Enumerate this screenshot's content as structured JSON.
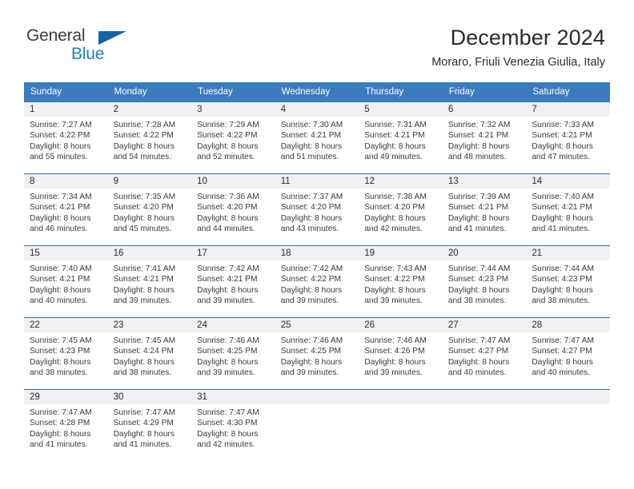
{
  "brand": {
    "line1": "General",
    "line2": "Blue",
    "triangle_icon": "triangle-logo-icon",
    "color_dark": "#3b3b3b",
    "color_blue": "#1f7fc4"
  },
  "header": {
    "title": "December 2024",
    "subtitle": "Moraro, Friuli Venezia Giulia, Italy"
  },
  "colors": {
    "header_blue": "#3a7cbe",
    "rule_blue": "#2f6fad",
    "date_band": "#f0f0f0"
  },
  "weekday_headers": [
    "Sunday",
    "Monday",
    "Tuesday",
    "Wednesday",
    "Thursday",
    "Friday",
    "Saturday"
  ],
  "weeks": [
    [
      {
        "day": "1",
        "sunrise": "Sunrise: 7:27 AM",
        "sunset": "Sunset: 4:22 PM",
        "daylight1": "Daylight: 8 hours",
        "daylight2": "and 55 minutes."
      },
      {
        "day": "2",
        "sunrise": "Sunrise: 7:28 AM",
        "sunset": "Sunset: 4:22 PM",
        "daylight1": "Daylight: 8 hours",
        "daylight2": "and 54 minutes."
      },
      {
        "day": "3",
        "sunrise": "Sunrise: 7:29 AM",
        "sunset": "Sunset: 4:22 PM",
        "daylight1": "Daylight: 8 hours",
        "daylight2": "and 52 minutes."
      },
      {
        "day": "4",
        "sunrise": "Sunrise: 7:30 AM",
        "sunset": "Sunset: 4:21 PM",
        "daylight1": "Daylight: 8 hours",
        "daylight2": "and 51 minutes."
      },
      {
        "day": "5",
        "sunrise": "Sunrise: 7:31 AM",
        "sunset": "Sunset: 4:21 PM",
        "daylight1": "Daylight: 8 hours",
        "daylight2": "and 49 minutes."
      },
      {
        "day": "6",
        "sunrise": "Sunrise: 7:32 AM",
        "sunset": "Sunset: 4:21 PM",
        "daylight1": "Daylight: 8 hours",
        "daylight2": "and 48 minutes."
      },
      {
        "day": "7",
        "sunrise": "Sunrise: 7:33 AM",
        "sunset": "Sunset: 4:21 PM",
        "daylight1": "Daylight: 8 hours",
        "daylight2": "and 47 minutes."
      }
    ],
    [
      {
        "day": "8",
        "sunrise": "Sunrise: 7:34 AM",
        "sunset": "Sunset: 4:21 PM",
        "daylight1": "Daylight: 8 hours",
        "daylight2": "and 46 minutes."
      },
      {
        "day": "9",
        "sunrise": "Sunrise: 7:35 AM",
        "sunset": "Sunset: 4:20 PM",
        "daylight1": "Daylight: 8 hours",
        "daylight2": "and 45 minutes."
      },
      {
        "day": "10",
        "sunrise": "Sunrise: 7:36 AM",
        "sunset": "Sunset: 4:20 PM",
        "daylight1": "Daylight: 8 hours",
        "daylight2": "and 44 minutes."
      },
      {
        "day": "11",
        "sunrise": "Sunrise: 7:37 AM",
        "sunset": "Sunset: 4:20 PM",
        "daylight1": "Daylight: 8 hours",
        "daylight2": "and 43 minutes."
      },
      {
        "day": "12",
        "sunrise": "Sunrise: 7:38 AM",
        "sunset": "Sunset: 4:20 PM",
        "daylight1": "Daylight: 8 hours",
        "daylight2": "and 42 minutes."
      },
      {
        "day": "13",
        "sunrise": "Sunrise: 7:39 AM",
        "sunset": "Sunset: 4:21 PM",
        "daylight1": "Daylight: 8 hours",
        "daylight2": "and 41 minutes."
      },
      {
        "day": "14",
        "sunrise": "Sunrise: 7:40 AM",
        "sunset": "Sunset: 4:21 PM",
        "daylight1": "Daylight: 8 hours",
        "daylight2": "and 41 minutes."
      }
    ],
    [
      {
        "day": "15",
        "sunrise": "Sunrise: 7:40 AM",
        "sunset": "Sunset: 4:21 PM",
        "daylight1": "Daylight: 8 hours",
        "daylight2": "and 40 minutes."
      },
      {
        "day": "16",
        "sunrise": "Sunrise: 7:41 AM",
        "sunset": "Sunset: 4:21 PM",
        "daylight1": "Daylight: 8 hours",
        "daylight2": "and 39 minutes."
      },
      {
        "day": "17",
        "sunrise": "Sunrise: 7:42 AM",
        "sunset": "Sunset: 4:21 PM",
        "daylight1": "Daylight: 8 hours",
        "daylight2": "and 39 minutes."
      },
      {
        "day": "18",
        "sunrise": "Sunrise: 7:42 AM",
        "sunset": "Sunset: 4:22 PM",
        "daylight1": "Daylight: 8 hours",
        "daylight2": "and 39 minutes."
      },
      {
        "day": "19",
        "sunrise": "Sunrise: 7:43 AM",
        "sunset": "Sunset: 4:22 PM",
        "daylight1": "Daylight: 8 hours",
        "daylight2": "and 39 minutes."
      },
      {
        "day": "20",
        "sunrise": "Sunrise: 7:44 AM",
        "sunset": "Sunset: 4:23 PM",
        "daylight1": "Daylight: 8 hours",
        "daylight2": "and 38 minutes."
      },
      {
        "day": "21",
        "sunrise": "Sunrise: 7:44 AM",
        "sunset": "Sunset: 4:23 PM",
        "daylight1": "Daylight: 8 hours",
        "daylight2": "and 38 minutes."
      }
    ],
    [
      {
        "day": "22",
        "sunrise": "Sunrise: 7:45 AM",
        "sunset": "Sunset: 4:23 PM",
        "daylight1": "Daylight: 8 hours",
        "daylight2": "and 38 minutes."
      },
      {
        "day": "23",
        "sunrise": "Sunrise: 7:45 AM",
        "sunset": "Sunset: 4:24 PM",
        "daylight1": "Daylight: 8 hours",
        "daylight2": "and 38 minutes."
      },
      {
        "day": "24",
        "sunrise": "Sunrise: 7:46 AM",
        "sunset": "Sunset: 4:25 PM",
        "daylight1": "Daylight: 8 hours",
        "daylight2": "and 39 minutes."
      },
      {
        "day": "25",
        "sunrise": "Sunrise: 7:46 AM",
        "sunset": "Sunset: 4:25 PM",
        "daylight1": "Daylight: 8 hours",
        "daylight2": "and 39 minutes."
      },
      {
        "day": "26",
        "sunrise": "Sunrise: 7:46 AM",
        "sunset": "Sunset: 4:26 PM",
        "daylight1": "Daylight: 8 hours",
        "daylight2": "and 39 minutes."
      },
      {
        "day": "27",
        "sunrise": "Sunrise: 7:47 AM",
        "sunset": "Sunset: 4:27 PM",
        "daylight1": "Daylight: 8 hours",
        "daylight2": "and 40 minutes."
      },
      {
        "day": "28",
        "sunrise": "Sunrise: 7:47 AM",
        "sunset": "Sunset: 4:27 PM",
        "daylight1": "Daylight: 8 hours",
        "daylight2": "and 40 minutes."
      }
    ],
    [
      {
        "day": "29",
        "sunrise": "Sunrise: 7:47 AM",
        "sunset": "Sunset: 4:28 PM",
        "daylight1": "Daylight: 8 hours",
        "daylight2": "and 41 minutes."
      },
      {
        "day": "30",
        "sunrise": "Sunrise: 7:47 AM",
        "sunset": "Sunset: 4:29 PM",
        "daylight1": "Daylight: 8 hours",
        "daylight2": "and 41 minutes."
      },
      {
        "day": "31",
        "sunrise": "Sunrise: 7:47 AM",
        "sunset": "Sunset: 4:30 PM",
        "daylight1": "Daylight: 8 hours",
        "daylight2": "and 42 minutes."
      },
      {
        "day": "",
        "sunrise": "",
        "sunset": "",
        "daylight1": "",
        "daylight2": ""
      },
      {
        "day": "",
        "sunrise": "",
        "sunset": "",
        "daylight1": "",
        "daylight2": ""
      },
      {
        "day": "",
        "sunrise": "",
        "sunset": "",
        "daylight1": "",
        "daylight2": ""
      },
      {
        "day": "",
        "sunrise": "",
        "sunset": "",
        "daylight1": "",
        "daylight2": ""
      }
    ]
  ]
}
